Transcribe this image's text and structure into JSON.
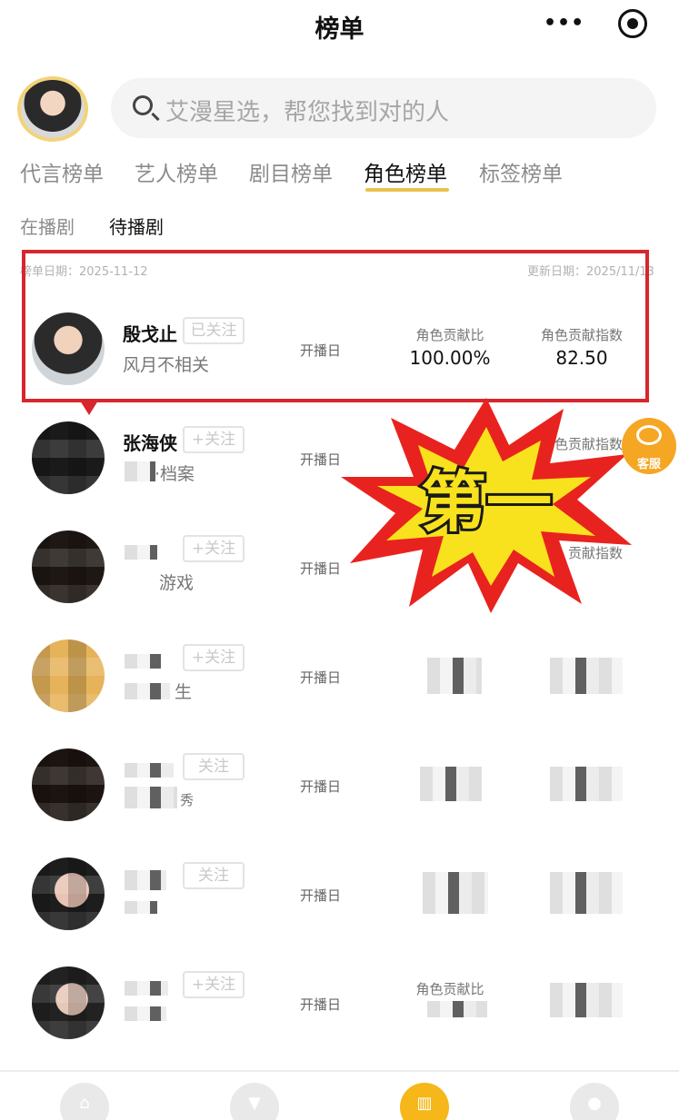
{
  "header": {
    "title": "榜单"
  },
  "search": {
    "placeholder": "艾漫星选，帮您找到对的人"
  },
  "tabs": [
    {
      "label": "代言榜单"
    },
    {
      "label": "艺人榜单"
    },
    {
      "label": "剧目榜单"
    },
    {
      "label": "角色榜单",
      "active": true
    },
    {
      "label": "标签榜单"
    }
  ],
  "subtabs": [
    {
      "label": "在播剧"
    },
    {
      "label": "待播剧",
      "active": true
    }
  ],
  "meta": {
    "left": "榜单日期：2025-11-12",
    "right": "更新日期：2025/11/13"
  },
  "rows": [
    {
      "name": "殷戈止",
      "follow": "已关注",
      "drama": "风月不相关",
      "date_label": "开播日",
      "stat1_label": "角色贡献比",
      "stat1_value": "100.00%",
      "stat2_label": "角色贡献指数",
      "stat2_value": "82.50"
    },
    {
      "name": "张海侠",
      "follow": "+关注",
      "drama": "·档案",
      "date_label": "开播日",
      "stat2_label": "角色贡献指数"
    },
    {
      "follow": "+关注",
      "drama": "游戏",
      "date_label": "开播日",
      "stat2_label": "贡献指数"
    },
    {
      "follow": "+关注",
      "drama": "生",
      "date_label": "开播日"
    },
    {
      "follow": "关注",
      "drama": "秀",
      "date_label": "开播日"
    },
    {
      "follow": "关注",
      "date_label": "开播日"
    },
    {
      "follow": "+关注",
      "date_label": "开播日",
      "stat1_label": "角色贡献比"
    }
  ],
  "overlay": {
    "text": "第一"
  },
  "service": {
    "label": "客服"
  },
  "colors": {
    "accent": "#f5b719",
    "highlight": "#d7262e",
    "burst_outer": "#e8231f",
    "burst_inner": "#f8e21d"
  }
}
